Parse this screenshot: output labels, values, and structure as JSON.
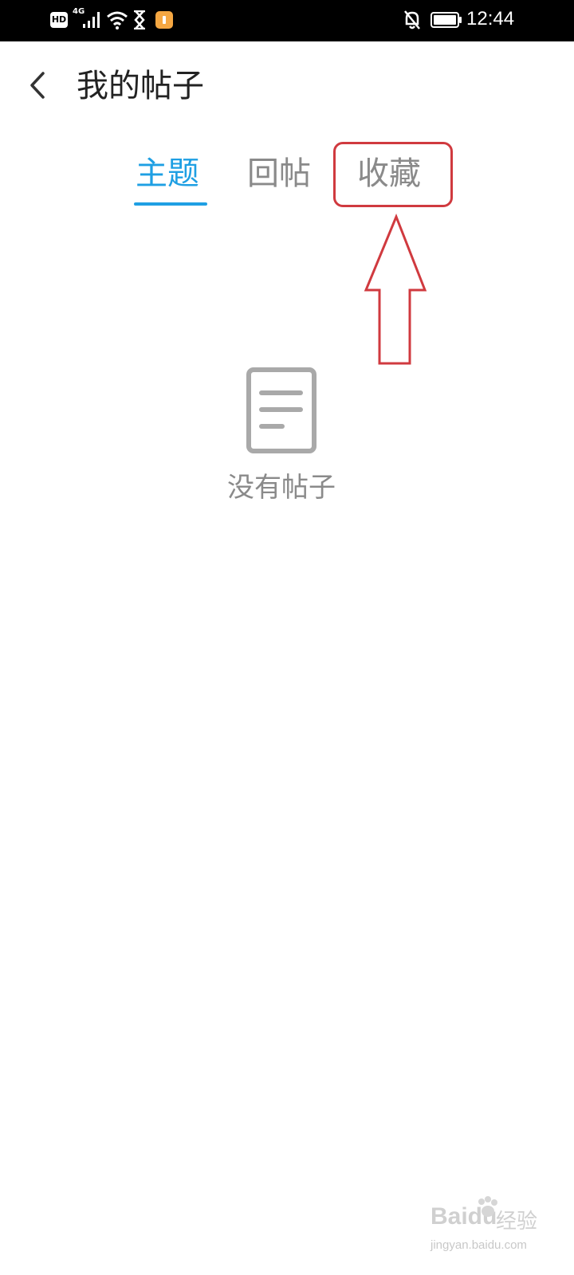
{
  "status_bar": {
    "hd_label": "HD",
    "network_label": "4G",
    "time": "12:44",
    "app_notification_color": "#f5a742",
    "icons": [
      "signal-icon",
      "wifi-icon",
      "hourglass-icon",
      "app-notification-icon",
      "bell-muted-icon",
      "battery-icon"
    ]
  },
  "header": {
    "back_icon": "chevron-left-icon",
    "title": "我的帖子"
  },
  "tabs": [
    {
      "label": "主题",
      "active": true
    },
    {
      "label": "回帖",
      "active": false
    },
    {
      "label": "收藏",
      "active": false
    }
  ],
  "empty_state": {
    "icon": "document-icon",
    "text": "没有帖子"
  },
  "annotation": {
    "color": "#d03a3f",
    "targets": "收藏"
  },
  "colors": {
    "accent": "#1e9fe3",
    "inactive_text": "#8a8a8a",
    "title_text": "#222222"
  },
  "watermark": {
    "logo": "Baidu",
    "cn": "经验",
    "url": "jingyan.baidu.com"
  }
}
